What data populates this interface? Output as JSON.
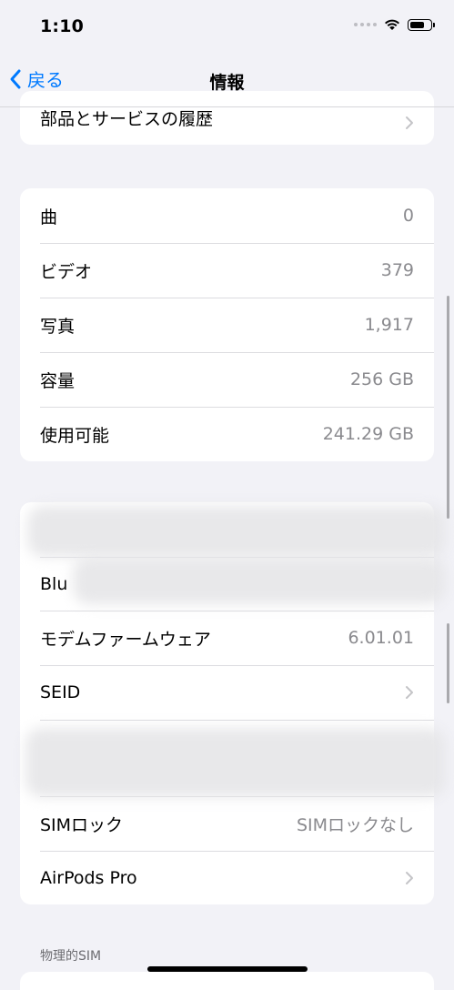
{
  "status_bar": {
    "time": "1:10"
  },
  "nav": {
    "back_label": "戻る",
    "title": "情報"
  },
  "top_card": {
    "label": "部品とサービスの履歴"
  },
  "stats": [
    {
      "label": "曲",
      "value": "0"
    },
    {
      "label": "ビデオ",
      "value": "379"
    },
    {
      "label": "写真",
      "value": "1,917"
    },
    {
      "label": "容量",
      "value": "256 GB"
    },
    {
      "label": "使用可能",
      "value": "241.29 GB"
    }
  ],
  "hardware": {
    "bluetooth_partial": "Blu",
    "modem_label": "モデムファームウェア",
    "modem_value": "6.01.01",
    "seid_label": "SEID",
    "sim_lock_label": "SIMロック",
    "sim_lock_value": "SIMロックなし",
    "airpods_label": "AirPods Pro"
  },
  "section_footer": "物理的SIM"
}
